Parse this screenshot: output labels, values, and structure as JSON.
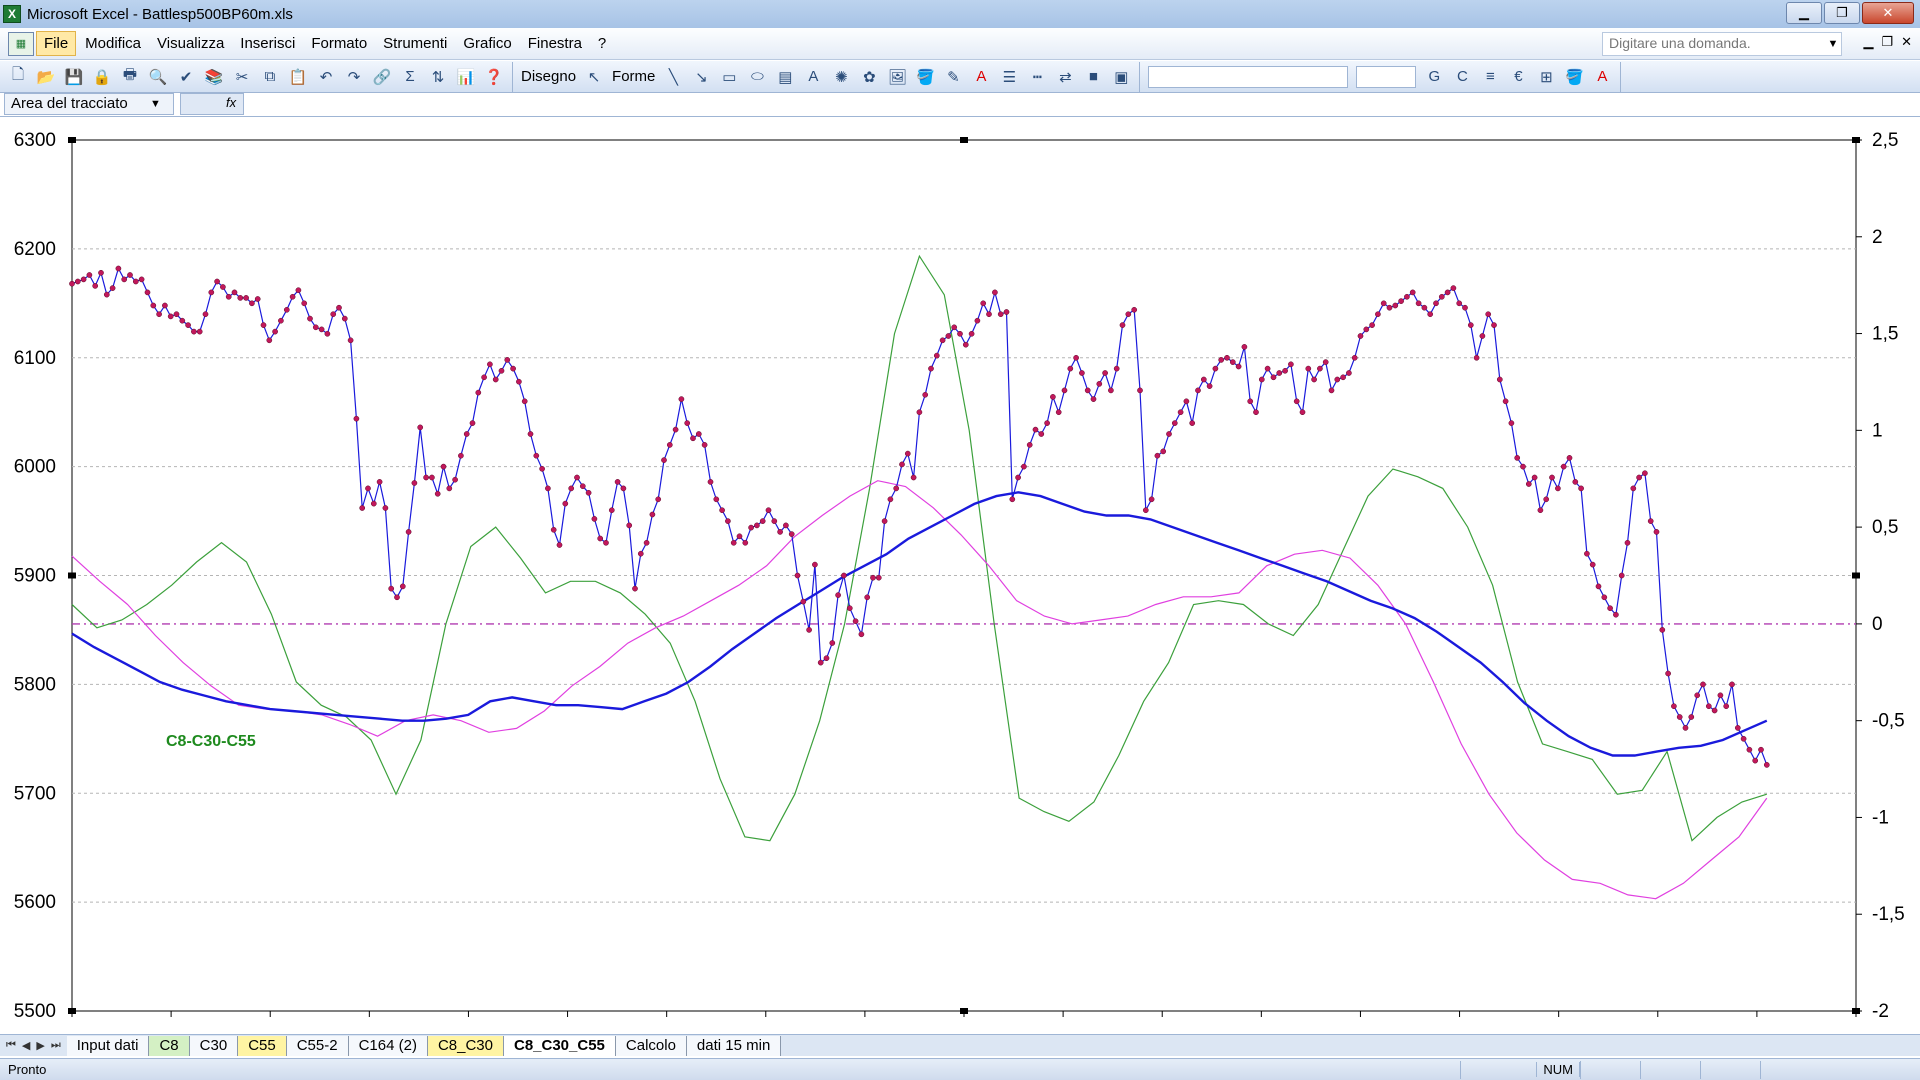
{
  "window": {
    "title": "Microsoft Excel - Battlesp500BP60m.xls",
    "minimize": "▁",
    "restore": "❐",
    "close": "✕"
  },
  "menu": {
    "items": [
      "File",
      "Modifica",
      "Visualizza",
      "Inserisci",
      "Formato",
      "Strumenti",
      "Grafico",
      "Finestra",
      "?"
    ],
    "ask_placeholder": "Digitare una domanda."
  },
  "toolbar": {
    "disegno_label": "Disegno",
    "forme_label": "Forme",
    "bold": "G",
    "italic": "C",
    "euro": "€"
  },
  "namebox": {
    "value": "Area del tracciato",
    "fx": "fx"
  },
  "chart_data": {
    "type": "line",
    "title": "",
    "annotation": "C8-C30-C55",
    "annotation_color": "#1e8a1e",
    "ylim_left": [
      5500,
      6300
    ],
    "ylim_right": [
      -2,
      2.5
    ],
    "yticks_left": [
      "6300",
      "6200",
      "6100",
      "6000",
      "5900",
      "5800",
      "5700",
      "5600",
      "5500"
    ],
    "yticks_right": [
      "2,5",
      "2",
      "1,5",
      "1",
      "0,5",
      "0",
      "-0,5",
      "-1",
      "-1,5",
      "-2"
    ],
    "grid": true,
    "zero_line": 0,
    "series": [
      {
        "axis": "left",
        "color": "#1a1adc",
        "marker_color": "#c2185b",
        "values": [
          6168,
          6170,
          6172,
          6176,
          6166,
          6178,
          6158,
          6164,
          6182,
          6172,
          6176,
          6170,
          6172,
          6160,
          6148,
          6140,
          6148,
          6138,
          6140,
          6134,
          6130,
          6124,
          6124,
          6140,
          6160,
          6170,
          6165,
          6156,
          6160,
          6155,
          6155,
          6150,
          6154,
          6130,
          6116,
          6124,
          6134,
          6144,
          6156,
          6162,
          6150,
          6136,
          6128,
          6126,
          6122,
          6140,
          6146,
          6136,
          6116,
          6044,
          5962,
          5980,
          5966,
          5986,
          5962,
          5888,
          5880,
          5890,
          5940,
          5985,
          6036,
          5990,
          5990,
          5975,
          6000,
          5980,
          5988,
          6010,
          6030,
          6040,
          6068,
          6082,
          6094,
          6080,
          6088,
          6098,
          6090,
          6078,
          6060,
          6030,
          6010,
          5998,
          5980,
          5942,
          5928,
          5966,
          5980,
          5990,
          5982,
          5976,
          5952,
          5934,
          5930,
          5960,
          5986,
          5980,
          5946,
          5888,
          5920,
          5930,
          5956,
          5970,
          6006,
          6020,
          6034,
          6062,
          6040,
          6026,
          6030,
          6020,
          5986,
          5970,
          5960,
          5950,
          5930,
          5936,
          5930,
          5944,
          5946,
          5950,
          5960,
          5950,
          5940,
          5946,
          5938,
          5900,
          5876,
          5850,
          5910,
          5820,
          5824,
          5838,
          5882,
          5900,
          5870,
          5858,
          5846,
          5880,
          5898,
          5898,
          5950,
          5970,
          5980,
          6002,
          6012,
          5990,
          6050,
          6066,
          6090,
          6102,
          6116,
          6120,
          6128,
          6122,
          6112,
          6122,
          6134,
          6150,
          6140,
          6160,
          6140,
          6142,
          5970,
          5990,
          6000,
          6020,
          6034,
          6030,
          6040,
          6064,
          6050,
          6070,
          6090,
          6100,
          6086,
          6070,
          6062,
          6076,
          6086,
          6070,
          6090,
          6130,
          6140,
          6144,
          6070,
          5960,
          5970,
          6010,
          6014,
          6030,
          6040,
          6050,
          6060,
          6040,
          6070,
          6080,
          6074,
          6090,
          6098,
          6100,
          6096,
          6092,
          6110,
          6060,
          6050,
          6080,
          6090,
          6082,
          6086,
          6088,
          6094,
          6060,
          6050,
          6090,
          6080,
          6090,
          6096,
          6070,
          6080,
          6082,
          6086,
          6100,
          6120,
          6126,
          6130,
          6140,
          6150,
          6146,
          6148,
          6152,
          6156,
          6160,
          6150,
          6146,
          6140,
          6150,
          6156,
          6160,
          6164,
          6150,
          6146,
          6130,
          6100,
          6120,
          6140,
          6130,
          6080,
          6060,
          6040,
          6008,
          6000,
          5984,
          5990,
          5960,
          5970,
          5990,
          5980,
          6000,
          6008,
          5986,
          5980,
          5920,
          5910,
          5890,
          5880,
          5870,
          5864,
          5900,
          5930,
          5980,
          5990,
          5994,
          5950,
          5940,
          5850,
          5810,
          5780,
          5770,
          5760,
          5770,
          5790,
          5800,
          5780,
          5776,
          5790,
          5780,
          5800,
          5760,
          5750,
          5740,
          5730,
          5740,
          5726
        ]
      },
      {
        "axis": "right",
        "color": "#1a1adc",
        "width": 2.4,
        "values": [
          -0.05,
          -0.12,
          -0.18,
          -0.24,
          -0.3,
          -0.34,
          -0.37,
          -0.4,
          -0.42,
          -0.44,
          -0.45,
          -0.46,
          -0.47,
          -0.48,
          -0.49,
          -0.5,
          -0.5,
          -0.49,
          -0.47,
          -0.4,
          -0.38,
          -0.4,
          -0.42,
          -0.42,
          -0.43,
          -0.44,
          -0.4,
          -0.36,
          -0.3,
          -0.22,
          -0.13,
          -0.05,
          0.03,
          0.1,
          0.17,
          0.24,
          0.3,
          0.36,
          0.44,
          0.5,
          0.56,
          0.62,
          0.66,
          0.68,
          0.66,
          0.62,
          0.58,
          0.56,
          0.56,
          0.54,
          0.5,
          0.46,
          0.42,
          0.38,
          0.34,
          0.3,
          0.26,
          0.22,
          0.17,
          0.12,
          0.08,
          0.03,
          -0.04,
          -0.12,
          -0.2,
          -0.3,
          -0.41,
          -0.5,
          -0.58,
          -0.64,
          -0.68,
          -0.68,
          -0.66,
          -0.64,
          -0.63,
          -0.6,
          -0.55,
          -0.5
        ],
        "x_span": [
          0,
          1
        ]
      },
      {
        "axis": "right",
        "color": "#e040e0",
        "width": 1.2,
        "values": [
          0.35,
          0.22,
          0.1,
          -0.06,
          -0.2,
          -0.32,
          -0.42,
          -0.44,
          -0.45,
          -0.47,
          -0.52,
          -0.58,
          -0.5,
          -0.47,
          -0.5,
          -0.56,
          -0.54,
          -0.45,
          -0.32,
          -0.22,
          -0.1,
          -0.02,
          0.04,
          0.12,
          0.2,
          0.3,
          0.45,
          0.56,
          0.66,
          0.74,
          0.71,
          0.6,
          0.46,
          0.3,
          0.12,
          0.04,
          0.0,
          0.02,
          0.04,
          0.1,
          0.14,
          0.14,
          0.16,
          0.3,
          0.36,
          0.38,
          0.34,
          0.2,
          0.0,
          -0.3,
          -0.62,
          -0.88,
          -1.08,
          -1.22,
          -1.32,
          -1.34,
          -1.4,
          -1.42,
          -1.34,
          -1.22,
          -1.1,
          -0.9
        ]
      },
      {
        "axis": "right",
        "color": "#3ca03c",
        "width": 1.2,
        "values": [
          0.1,
          -0.02,
          0.02,
          0.1,
          0.2,
          0.32,
          0.42,
          0.32,
          0.05,
          -0.3,
          -0.42,
          -0.48,
          -0.6,
          -0.88,
          -0.6,
          0.0,
          0.4,
          0.5,
          0.34,
          0.16,
          0.22,
          0.22,
          0.16,
          0.05,
          -0.1,
          -0.4,
          -0.8,
          -1.1,
          -1.12,
          -0.88,
          -0.5,
          0.0,
          0.7,
          1.5,
          1.9,
          1.7,
          1.0,
          0.0,
          -0.9,
          -0.97,
          -1.02,
          -0.92,
          -0.68,
          -0.4,
          -0.2,
          0.1,
          0.12,
          0.1,
          0.0,
          -0.06,
          0.1,
          0.38,
          0.66,
          0.8,
          0.76,
          0.7,
          0.5,
          0.2,
          -0.3,
          -0.62,
          -0.66,
          -0.7,
          -0.88,
          -0.86,
          -0.66,
          -1.12,
          -1.0,
          -0.92,
          -0.88
        ]
      }
    ]
  },
  "sheet_tabs": [
    {
      "label": "Input dati",
      "style": "plain"
    },
    {
      "label": "C8",
      "style": "green"
    },
    {
      "label": "C30",
      "style": "plain"
    },
    {
      "label": "C55",
      "style": "yellow"
    },
    {
      "label": "C55-2",
      "style": "plain"
    },
    {
      "label": "C164 (2)",
      "style": "plain"
    },
    {
      "label": "C8_C30",
      "style": "yellow"
    },
    {
      "label": "C8_C30_C55",
      "style": "active"
    },
    {
      "label": "Calcolo",
      "style": "plain"
    },
    {
      "label": "dati 15 min",
      "style": "plain"
    }
  ],
  "status": {
    "ready": "Pronto",
    "num": "NUM"
  }
}
